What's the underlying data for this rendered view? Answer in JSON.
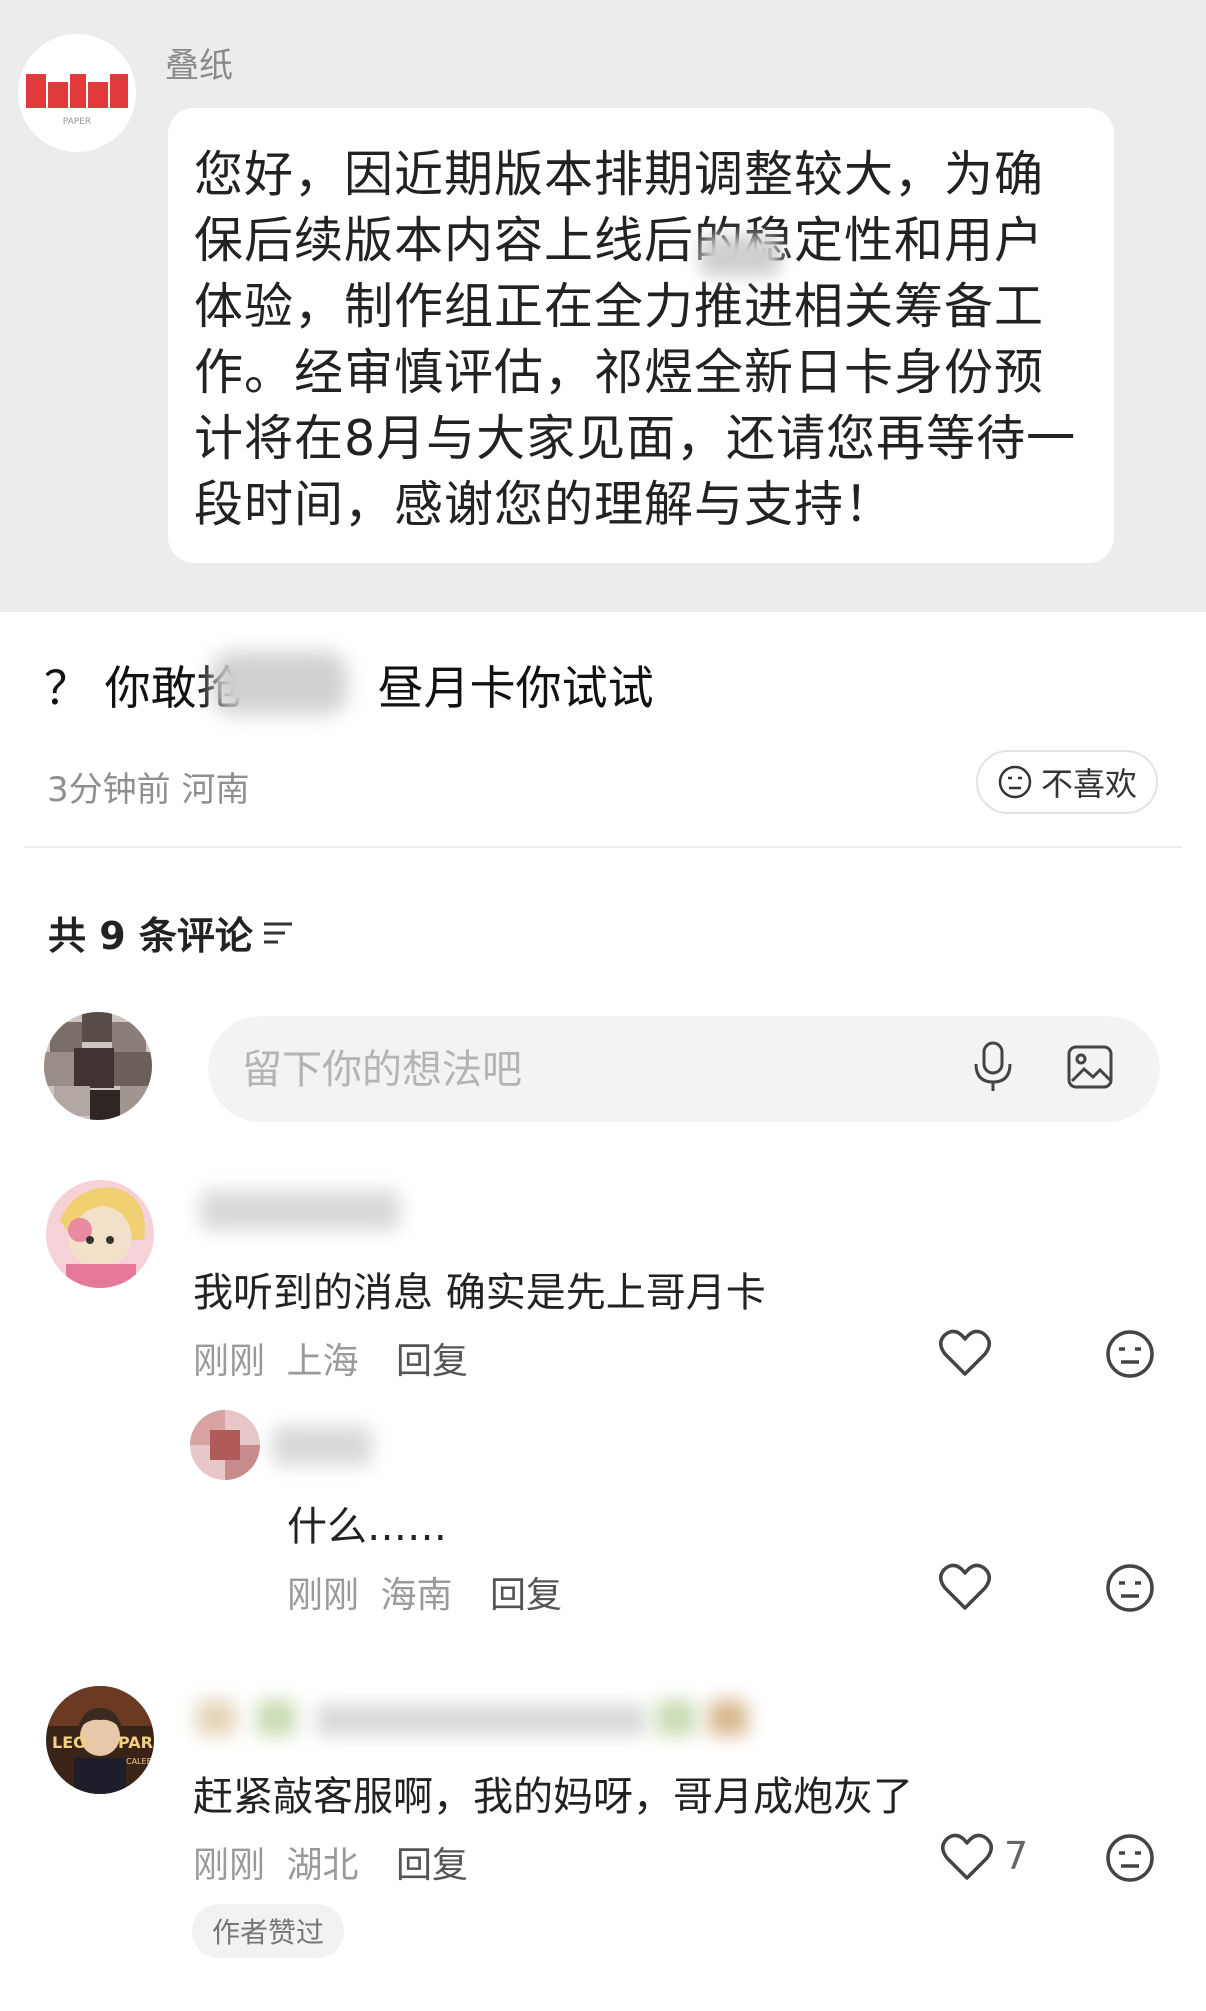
{
  "quoted": {
    "sender_name": "叠纸",
    "logo_text": "PAPER",
    "message": "您好，因近期版本排期调整较大，为确保后续版本内容上线后的稳定性和用户体验，制作组正在全力推进相关筹备工作。经审慎评估，祁煜全新日卡身份预计将在8月与大家见面，还请您再等待一段时间，感谢您的理解与支持！"
  },
  "post": {
    "text_prefix": "？ 你敢抢",
    "text_suffix": "昼月卡你试试",
    "time": "3分钟前",
    "location": "河南",
    "dislike_label": "不喜欢"
  },
  "comments_header": {
    "label": "共 9 条评论"
  },
  "comment_input": {
    "placeholder": "留下你的想法吧"
  },
  "comments": [
    {
      "text": "我听到的消息 确实是先上哥月卡",
      "time": "刚刚",
      "location": "上海",
      "reply_label": "回复"
    },
    {
      "text": "什么……",
      "time": "刚刚",
      "location": "海南",
      "reply_label": "回复"
    },
    {
      "text": "赶紧敲客服啊，我的妈呀，哥月成炮灰了",
      "time": "刚刚",
      "location": "湖北",
      "reply_label": "回复",
      "like_count": "7",
      "badge": "作者赞过",
      "avatar_text_left": "LEO",
      "avatar_text_right": "PARI",
      "avatar_text_bottom": "CALEB"
    }
  ],
  "colors": {
    "quote_background": "#ececec",
    "logo_red": "#e23a3a",
    "muted_text": "#9a9a9a",
    "divider": "#eeeeee"
  },
  "icons": [
    "mic-icon",
    "image-icon",
    "heart-icon",
    "dislike-face-icon",
    "sort-icon"
  ]
}
